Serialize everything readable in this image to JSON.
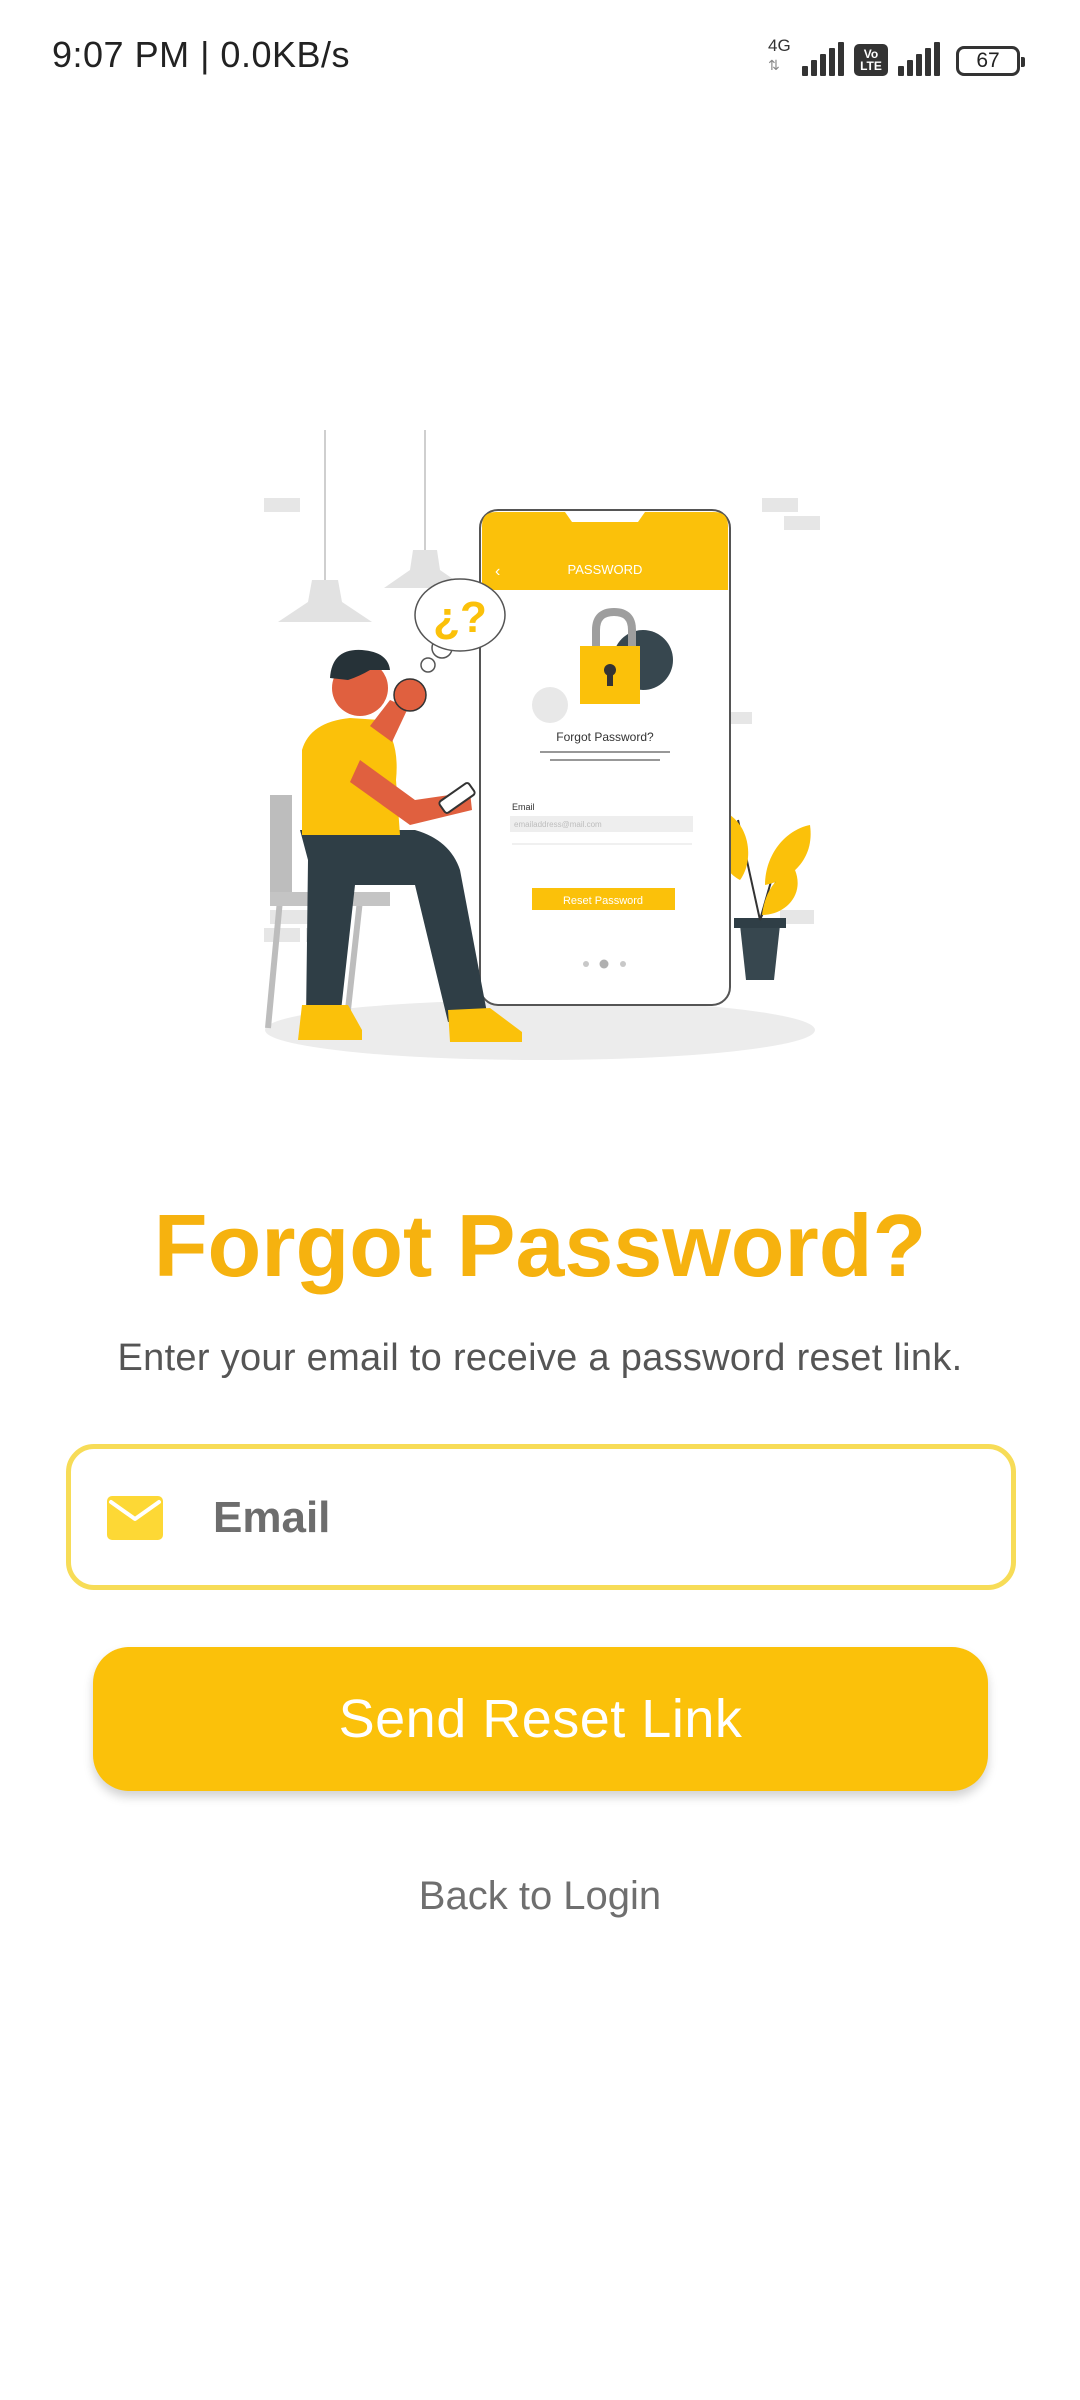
{
  "status_bar": {
    "time_speed": "9:07 PM | 0.0KB/s",
    "network": "4G",
    "volte_top": "Vo",
    "volte_bottom": "LTE",
    "battery": "67"
  },
  "illustration": {
    "screen_header": "PASSWORD",
    "screen_title": "Forgot Password?",
    "screen_email_label": "Email",
    "screen_email_placeholder": "emailaddress@mail.com",
    "screen_button": "Reset Password",
    "thought_text": "¿?"
  },
  "page": {
    "title": "Forgot Password?",
    "subtitle": "Enter your email to receive a password reset link."
  },
  "email": {
    "placeholder": "Email",
    "value": ""
  },
  "actions": {
    "send_label": "Send Reset Link",
    "back_label": "Back to Login"
  },
  "colors": {
    "accent": "#FBC10A",
    "title": "#F6B20F",
    "field_border": "#F7DC57",
    "icon": "#FDD835"
  }
}
